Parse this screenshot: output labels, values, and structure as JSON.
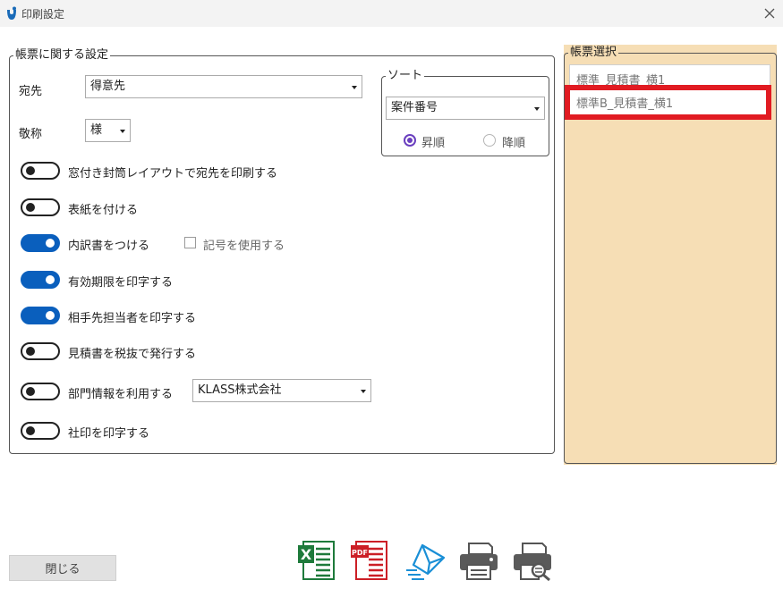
{
  "window": {
    "title": "印刷設定"
  },
  "settings_group": {
    "legend": "帳票に関する設定",
    "recipient_label": "宛先",
    "recipient_value": "得意先",
    "honorific_label": "敬称",
    "honorific_value": "様",
    "toggles": [
      {
        "label": "窓付き封筒レイアウトで宛先を印刷する",
        "on": false
      },
      {
        "label": "表紙を付ける",
        "on": false
      },
      {
        "label": "内訳書をつける",
        "on": true
      },
      {
        "label": "有効期限を印字する",
        "on": true
      },
      {
        "label": "相手先担当者を印字する",
        "on": true
      },
      {
        "label": "見積書を税抜で発行する",
        "on": false
      },
      {
        "label": "部門情報を利用する",
        "on": false
      },
      {
        "label": "社印を印字する",
        "on": false
      }
    ],
    "symbol_checkbox_label": "記号を使用する",
    "department_value": "KLASS株式会社"
  },
  "sort_group": {
    "legend": "ソート",
    "value": "案件番号",
    "ascending_label": "昇順",
    "descending_label": "降順"
  },
  "form_select_group": {
    "legend": "帳票選択",
    "items": [
      "標準_見積書_横1",
      "標準B_見積書_横1"
    ]
  },
  "footer": {
    "close_label": "閉じる"
  },
  "colors": {
    "toggle_on": "#0a5fbd",
    "panel_bg": "#f6deb5",
    "highlight": "#e11b22",
    "radio_accent": "#6a3fbf"
  }
}
